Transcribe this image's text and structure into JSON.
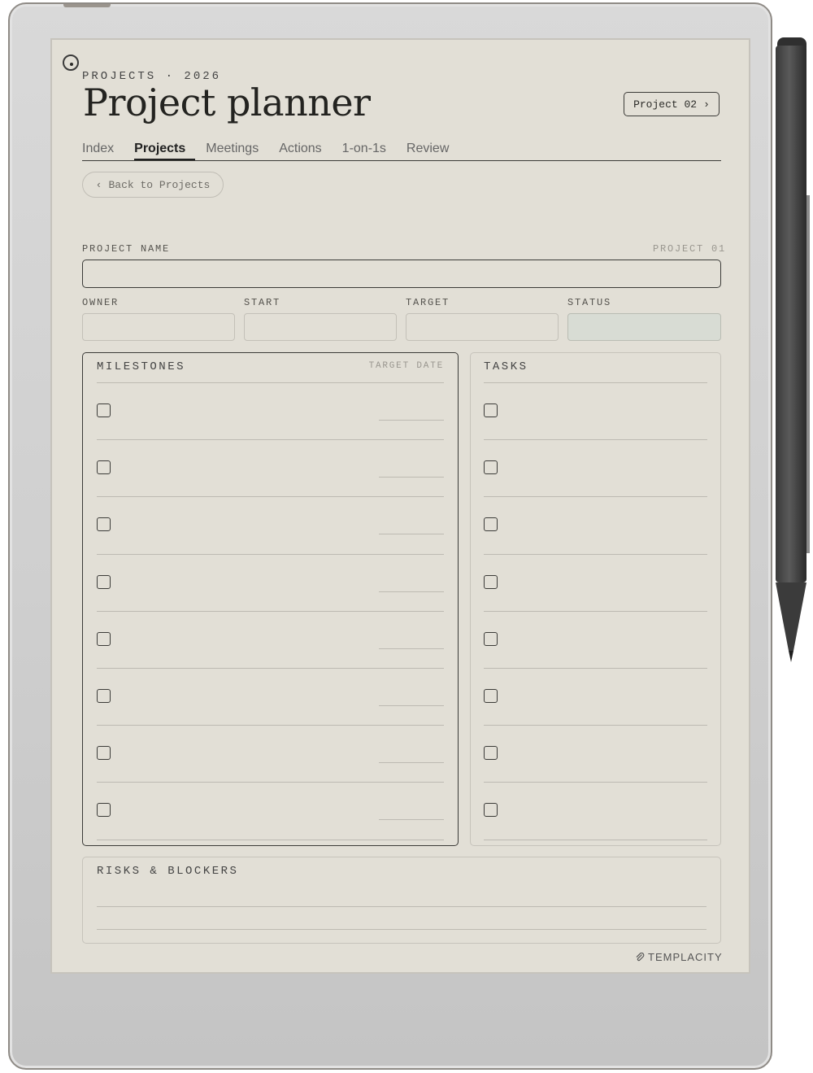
{
  "header": {
    "eyebrow": "PROJECTS · 2026",
    "title": "Project planner",
    "next_project_label": "Project 02",
    "next_icon": "chevron-right-icon"
  },
  "tabs": [
    {
      "label": "Index",
      "active": false
    },
    {
      "label": "Projects",
      "active": true
    },
    {
      "label": "Meetings",
      "active": false
    },
    {
      "label": "Actions",
      "active": false
    },
    {
      "label": "1-on-1s",
      "active": false
    },
    {
      "label": "Review",
      "active": false
    }
  ],
  "back_button": {
    "icon": "chevron-left-icon",
    "label": "Back to Projects"
  },
  "form": {
    "project_name_label": "PROJECT NAME",
    "project_number": "PROJECT 01",
    "project_name_value": "",
    "owner_label": "OWNER",
    "start_label": "START",
    "target_label": "TARGET",
    "status_label": "STATUS"
  },
  "milestones": {
    "title": "MILESTONES",
    "subtitle": "TARGET DATE",
    "rows": 8
  },
  "tasks": {
    "title": "TASKS",
    "rows": 8
  },
  "risks": {
    "title": "RISKS & BLOCKERS"
  },
  "branding": {
    "logo_text": "TEMPLACITY"
  },
  "colors": {
    "paper": "#e2dfd6",
    "ink": "#2b2b28",
    "status_fill": "#d8dcd4",
    "device": "#d3d3d3"
  }
}
